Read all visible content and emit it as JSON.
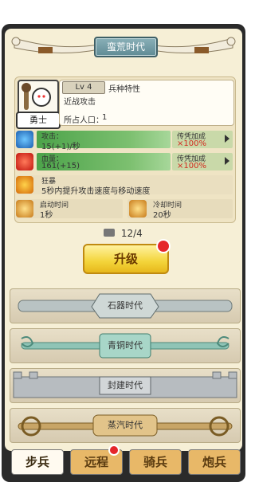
{
  "header": {
    "title": "蛮荒时代"
  },
  "unit": {
    "name": "勇士",
    "level": "Lv 4",
    "trait_title": "兵种特性",
    "trait_desc": "近战攻击",
    "population_label": "所占人口：",
    "population_value": "1"
  },
  "stats": {
    "attack": {
      "label": "攻击：",
      "value": "15(+1)/秒",
      "bonus_label": "传凭加成",
      "bonus_value": "×100%"
    },
    "hp": {
      "label": "血量：",
      "value": "161(+15)",
      "bonus_label": "传凭加成",
      "bonus_value": "×100%"
    },
    "skill": {
      "label": "狂暴",
      "desc": "5秒内提升攻击速度与移动速度"
    },
    "start_time": {
      "label": "启动时间",
      "value": "1秒"
    },
    "cooldown": {
      "label": "冷却时间",
      "value": "20秒"
    }
  },
  "cost": {
    "value": "12/4"
  },
  "upgrade": {
    "label": "升级"
  },
  "eras": [
    {
      "label": "石器时代"
    },
    {
      "label": "青铜时代"
    },
    {
      "label": "封建时代"
    },
    {
      "label": "蒸汽时代"
    }
  ],
  "tabs": [
    {
      "label": "步兵"
    },
    {
      "label": "远程"
    },
    {
      "label": "骑兵"
    },
    {
      "label": "炮兵"
    }
  ],
  "colors": {
    "panel": "#f6efd6",
    "upgrade_button": "#f3d43a",
    "badge_red": "#e5262b",
    "stat_green": "#4ca34a",
    "bonus_text": "#d22a1f"
  }
}
